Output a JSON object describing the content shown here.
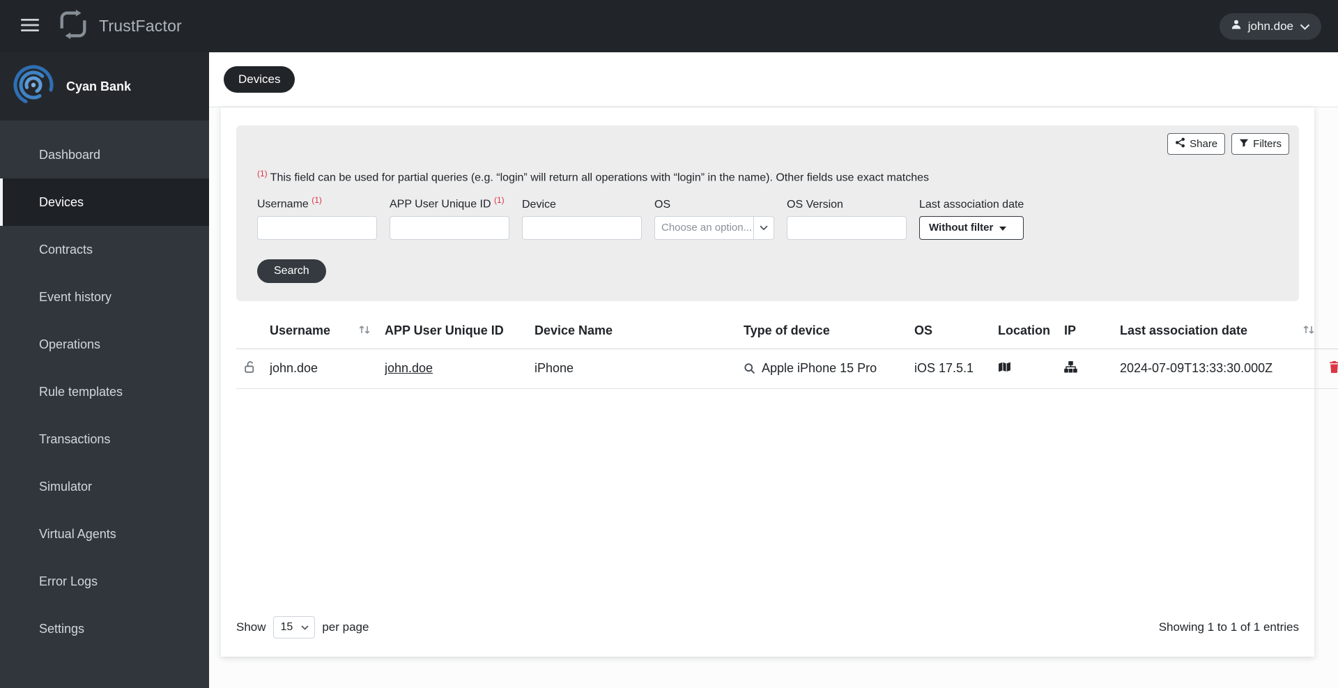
{
  "topbar": {
    "brand": "TrustFactor",
    "user": "john.doe"
  },
  "sidebar": {
    "org": "Cyan Bank",
    "items": [
      {
        "label": "Dashboard"
      },
      {
        "label": "Devices"
      },
      {
        "label": "Contracts"
      },
      {
        "label": "Event history"
      },
      {
        "label": "Operations"
      },
      {
        "label": "Rule templates"
      },
      {
        "label": "Transactions"
      },
      {
        "label": "Simulator"
      },
      {
        "label": "Virtual Agents"
      },
      {
        "label": "Error Logs"
      },
      {
        "label": "Settings"
      }
    ]
  },
  "page": {
    "title": "Devices"
  },
  "panel": {
    "share_label": "Share",
    "filters_label": "Filters",
    "note_marker": "(1)",
    "note": "This field can be used for partial queries (e.g. “login” will return all operations with “login” in the name). Other fields use exact matches",
    "search_label": "Search",
    "fields": {
      "username": {
        "label": "Username",
        "marker": "(1)",
        "value": ""
      },
      "app_user_id": {
        "label": "APP User Unique ID",
        "marker": "(1)",
        "value": ""
      },
      "device": {
        "label": "Device",
        "value": ""
      },
      "os": {
        "label": "OS",
        "placeholder": "Choose an option..."
      },
      "os_version": {
        "label": "OS Version",
        "value": ""
      },
      "last_association": {
        "label": "Last association date",
        "button": "Without filter"
      }
    }
  },
  "table": {
    "headers": [
      "Username",
      "APP User Unique ID",
      "Device Name",
      "Type of device",
      "OS",
      "Location",
      "IP",
      "Last association date"
    ],
    "rows": [
      {
        "username": "john.doe",
        "app_user_id": "john.doe",
        "device_name": "iPhone",
        "type_of_device": "Apple iPhone 15 Pro",
        "os": "iOS 17.5.1",
        "last_association_date": "2024-07-09T13:33:30.000Z"
      }
    ]
  },
  "pagination": {
    "show_label": "Show",
    "per_page": "15",
    "per_page_label": "per page",
    "summary": "Showing 1 to 1 of 1 entries"
  },
  "colors": {
    "accent_dark": "#212529",
    "danger": "#dc3545",
    "brand_blue": "#3f83c6"
  }
}
